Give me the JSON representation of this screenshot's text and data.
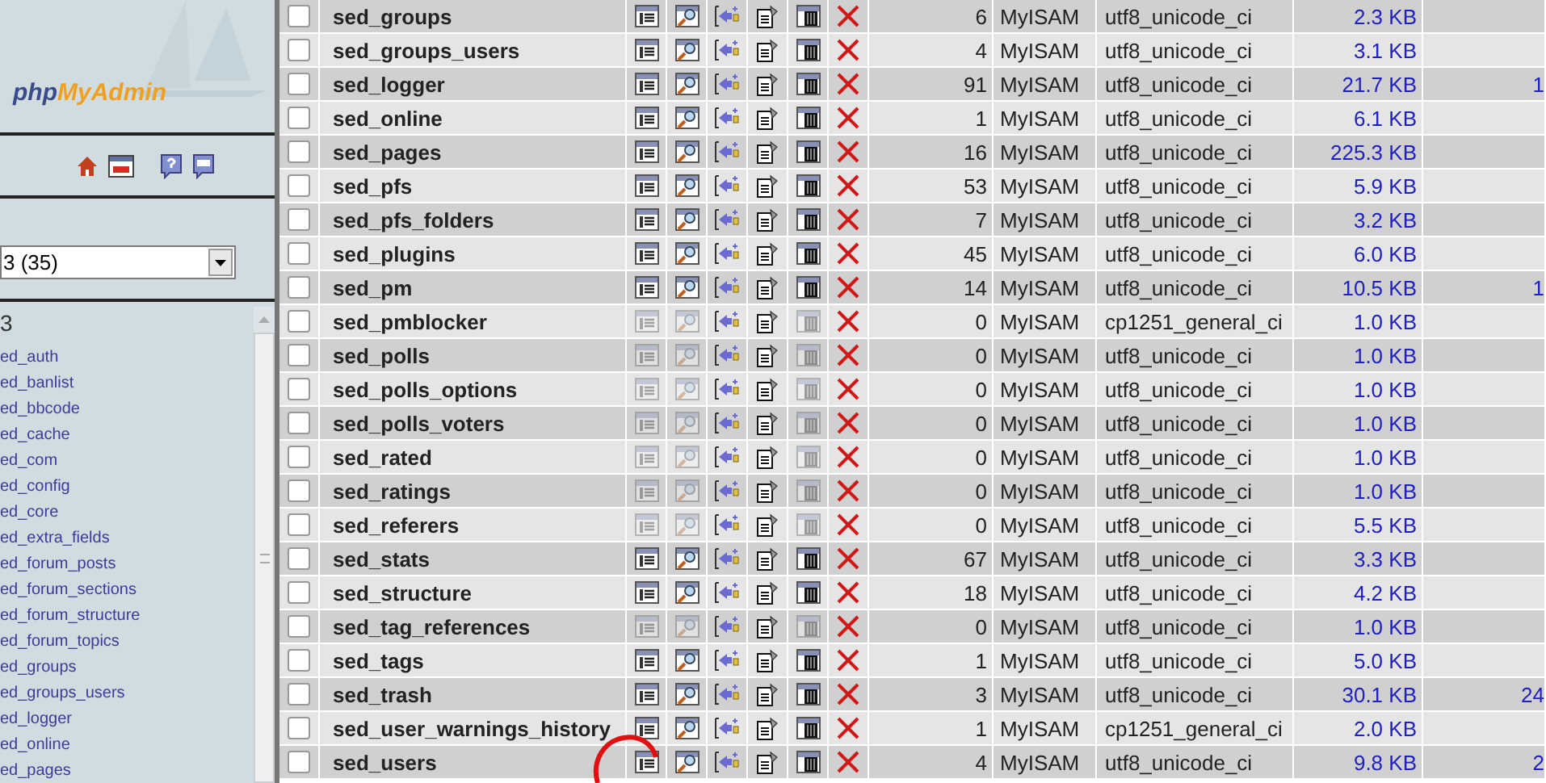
{
  "sidebar": {
    "logo": {
      "prefix": "php",
      "suffix": "MyAdmin"
    },
    "database_select": {
      "value": "3 (35)"
    },
    "database_heading": "3",
    "tables": [
      "ed_auth",
      "ed_banlist",
      "ed_bbcode",
      "ed_cache",
      "ed_com",
      "ed_config",
      "ed_core",
      "ed_extra_fields",
      "ed_forum_posts",
      "ed_forum_sections",
      "ed_forum_structure",
      "ed_forum_topics",
      "ed_groups",
      "ed_groups_users",
      "ed_logger",
      "ed_online",
      "ed_pages"
    ]
  },
  "table": {
    "rows": [
      {
        "name": "sed_groups",
        "checked": false,
        "has_rows": true,
        "rows": "6",
        "engine": "MyISAM",
        "collation": "utf8_unicode_ci",
        "size": "2.3 KB"
      },
      {
        "name": "sed_groups_users",
        "checked": false,
        "has_rows": true,
        "rows": "4",
        "engine": "MyISAM",
        "collation": "utf8_unicode_ci",
        "size": "3.1 KB"
      },
      {
        "name": "sed_logger",
        "checked": false,
        "has_rows": true,
        "rows": "91",
        "engine": "MyISAM",
        "collation": "utf8_unicode_ci",
        "size": "21.7 KB",
        "column_10": "1"
      },
      {
        "name": "sed_online",
        "checked": false,
        "has_rows": true,
        "rows": "1",
        "engine": "MyISAM",
        "collation": "utf8_unicode_ci",
        "size": "6.1 KB"
      },
      {
        "name": "sed_pages",
        "checked": false,
        "has_rows": true,
        "rows": "16",
        "engine": "MyISAM",
        "collation": "utf8_unicode_ci",
        "size": "225.3 KB"
      },
      {
        "name": "sed_pfs",
        "checked": false,
        "has_rows": true,
        "rows": "53",
        "engine": "MyISAM",
        "collation": "utf8_unicode_ci",
        "size": "5.9 KB"
      },
      {
        "name": "sed_pfs_folders",
        "checked": false,
        "has_rows": true,
        "rows": "7",
        "engine": "MyISAM",
        "collation": "utf8_unicode_ci",
        "size": "3.2 KB"
      },
      {
        "name": "sed_plugins",
        "checked": false,
        "has_rows": true,
        "rows": "45",
        "engine": "MyISAM",
        "collation": "utf8_unicode_ci",
        "size": "6.0 KB"
      },
      {
        "name": "sed_pm",
        "checked": false,
        "has_rows": true,
        "rows": "14",
        "engine": "MyISAM",
        "collation": "utf8_unicode_ci",
        "size": "10.5 KB",
        "column_10": "1"
      },
      {
        "name": "sed_pmblocker",
        "checked": false,
        "has_rows": false,
        "rows": "0",
        "engine": "MyISAM",
        "collation": "cp1251_general_ci",
        "size": "1.0 KB"
      },
      {
        "name": "sed_polls",
        "checked": false,
        "has_rows": false,
        "rows": "0",
        "engine": "MyISAM",
        "collation": "utf8_unicode_ci",
        "size": "1.0 KB"
      },
      {
        "name": "sed_polls_options",
        "checked": false,
        "has_rows": false,
        "rows": "0",
        "engine": "MyISAM",
        "collation": "utf8_unicode_ci",
        "size": "1.0 KB"
      },
      {
        "name": "sed_polls_voters",
        "checked": false,
        "has_rows": false,
        "rows": "0",
        "engine": "MyISAM",
        "collation": "utf8_unicode_ci",
        "size": "1.0 KB"
      },
      {
        "name": "sed_rated",
        "checked": false,
        "has_rows": false,
        "rows": "0",
        "engine": "MyISAM",
        "collation": "utf8_unicode_ci",
        "size": "1.0 KB"
      },
      {
        "name": "sed_ratings",
        "checked": false,
        "has_rows": false,
        "rows": "0",
        "engine": "MyISAM",
        "collation": "utf8_unicode_ci",
        "size": "1.0 KB"
      },
      {
        "name": "sed_referers",
        "checked": false,
        "has_rows": false,
        "rows": "0",
        "engine": "MyISAM",
        "collation": "utf8_unicode_ci",
        "size": "5.5 KB"
      },
      {
        "name": "sed_stats",
        "checked": false,
        "has_rows": true,
        "rows": "67",
        "engine": "MyISAM",
        "collation": "utf8_unicode_ci",
        "size": "3.3 KB"
      },
      {
        "name": "sed_structure",
        "checked": false,
        "has_rows": true,
        "rows": "18",
        "engine": "MyISAM",
        "collation": "utf8_unicode_ci",
        "size": "4.2 KB"
      },
      {
        "name": "sed_tag_references",
        "checked": false,
        "has_rows": false,
        "rows": "0",
        "engine": "MyISAM",
        "collation": "utf8_unicode_ci",
        "size": "1.0 KB"
      },
      {
        "name": "sed_tags",
        "checked": false,
        "has_rows": true,
        "rows": "1",
        "engine": "MyISAM",
        "collation": "utf8_unicode_ci",
        "size": "5.0 KB"
      },
      {
        "name": "sed_trash",
        "checked": false,
        "has_rows": true,
        "rows": "3",
        "engine": "MyISAM",
        "collation": "utf8_unicode_ci",
        "size": "30.1 KB",
        "column_10": "24"
      },
      {
        "name": "sed_user_warnings_history",
        "checked": false,
        "has_rows": true,
        "rows": "1",
        "engine": "MyISAM",
        "collation": "cp1251_general_ci",
        "size": "2.0 KB"
      },
      {
        "name": "sed_users",
        "checked": false,
        "has_rows": true,
        "rows": "4",
        "engine": "MyISAM",
        "collation": "utf8_unicode_ci",
        "size": "9.8 KB",
        "column_10": "2"
      }
    ]
  }
}
